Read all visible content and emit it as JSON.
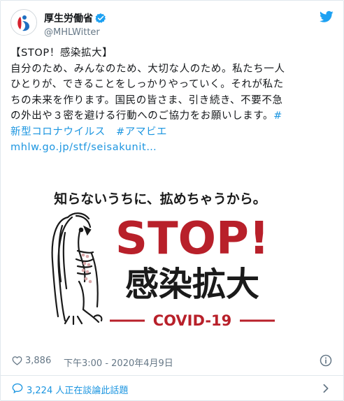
{
  "account": {
    "display_name": "厚生労働省",
    "handle": "@MHLWitter",
    "avatar_icon": "mhlw-logo-icon",
    "verified_icon": "verified-badge-icon"
  },
  "tweet": {
    "lines": [
      "【STOP！感染拡大】",
      "自分のため、みんなのため、大切な人のため。私たち一人",
      "ひとりが、できることをしっかりやっていく。それが私た",
      "ちの未来を作ります。国民の皆さま、引き続き、不要不急",
      "の外出や３密を避ける行動へのご協力をお願いします。"
    ],
    "hashtag_mark": "#",
    "hashtag_line": "新型コロナウイルス　#アマビエ",
    "link": "mhlw.go.jp/stf/seisakunit…"
  },
  "media": {
    "tagline": "知らないうちに、拡めちゃうから。",
    "headline": "STOP!",
    "subhead": "感染拡大",
    "label": "COVID-19",
    "accent_color": "#b8202a"
  },
  "meta": {
    "likes": "3,886",
    "timestamp": "下午3:00 - 2020年4月9日"
  },
  "replies": {
    "text": "3,224 人正在談論此話題"
  },
  "colors": {
    "link": "#1b95e0",
    "muted": "#657786",
    "border": "#e1e8ed"
  }
}
